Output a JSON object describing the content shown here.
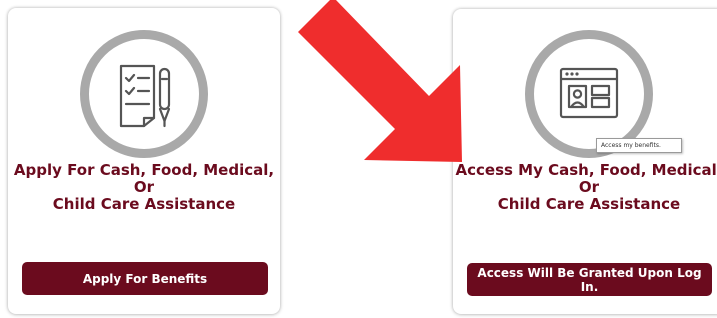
{
  "cards": [
    {
      "icon": "checklist-pen-icon",
      "title": "Apply For Cash, Food, Medical, Or\nChild Care Assistance",
      "button_label": "Apply For Benefits"
    },
    {
      "icon": "browser-profile-icon",
      "title": "Access My Cash, Food, Medical, Or\nChild Care Assistance",
      "button_label": "Access Will Be Granted Upon Log In."
    }
  ],
  "tooltip": "Access my benefits.",
  "annotation": {
    "icon": "red-arrow-icon"
  },
  "colors": {
    "brand": "#6b0b1e",
    "ring": "#a9a9a9",
    "annotation_arrow": "#ef2d2d"
  }
}
